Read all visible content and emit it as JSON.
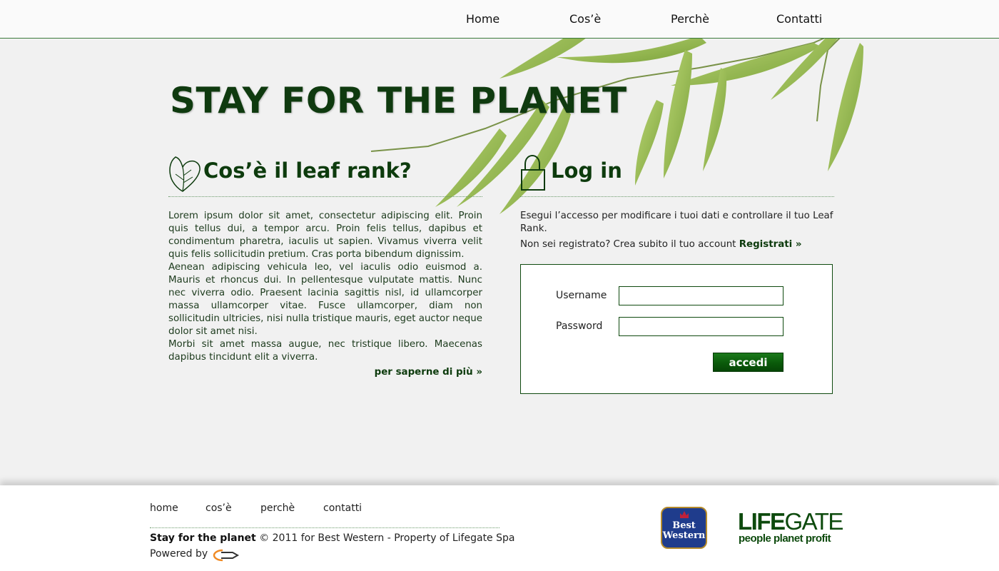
{
  "nav": {
    "items": [
      "Home",
      "Cos’è",
      "Perchè",
      "Contatti"
    ]
  },
  "site_title": "STAY FOR THE PLANET",
  "leaf_rank": {
    "heading": "Cos’è il leaf rank?",
    "paragraphs": [
      "Lorem ipsum dolor sit amet, consectetur adipiscing elit. Proin quis tellus dui, a tempor arcu. Proin felis tellus, dapibus et condimentum pharetra, iaculis ut sapien. Vivamus viverra velit quis felis sollicitudin pretium. Cras porta bibendum dignissim.",
      "Aenean adipiscing vehicula leo, vel iaculis odio euismod a. Mauris et rhoncus dui. In pellentesque vulputate mattis. Nunc nec viverra odio. Praesent lacinia sagittis nisl, id ullamcorper massa ullamcorper vitae. Fusce ullamcorper, diam non sollicitudin ultricies, nisi nulla tristique mauris, eget auctor neque dolor sit amet nisi.",
      "Morbi sit amet massa augue, nec tristique libero. Maecenas dapibus tincidunt elit a viverra."
    ],
    "more_link": "per saperne di più »"
  },
  "login": {
    "heading": "Log in",
    "description": "Esegui l’accesso per modificare i tuoi dati e controllare il tuo Leaf Rank.",
    "register_prompt": "Non sei registrato? Crea subito il tuo account",
    "register_link": "Registrati »",
    "username_label": "Username",
    "username_value": "",
    "password_label": "Password",
    "password_value": "",
    "submit_label": "accedi"
  },
  "footer": {
    "nav": [
      "home",
      "cos’è",
      "perchè",
      "contatti"
    ],
    "copyright_brand": "Stay for the planet",
    "copyright_text": "© 2011 for Best Western - Property of Lifegate Spa",
    "powered_by": "Powered by",
    "best_western_line1": "Best",
    "best_western_line2": "Western",
    "lifegate_name_1": "LIFE",
    "lifegate_name_2": "GATE",
    "lifegate_tagline": "people planet profit"
  },
  "colors": {
    "brand_green": "#0d3b0d",
    "button_green": "#0a5a0a",
    "leaf_green": "#8fb83a",
    "background": "#f1f1f1",
    "best_western_blue": "#1f3c8c"
  },
  "icons": [
    "leaf-icon",
    "lock-icon",
    "crown-icon",
    "powered-by-logo-icon"
  ]
}
